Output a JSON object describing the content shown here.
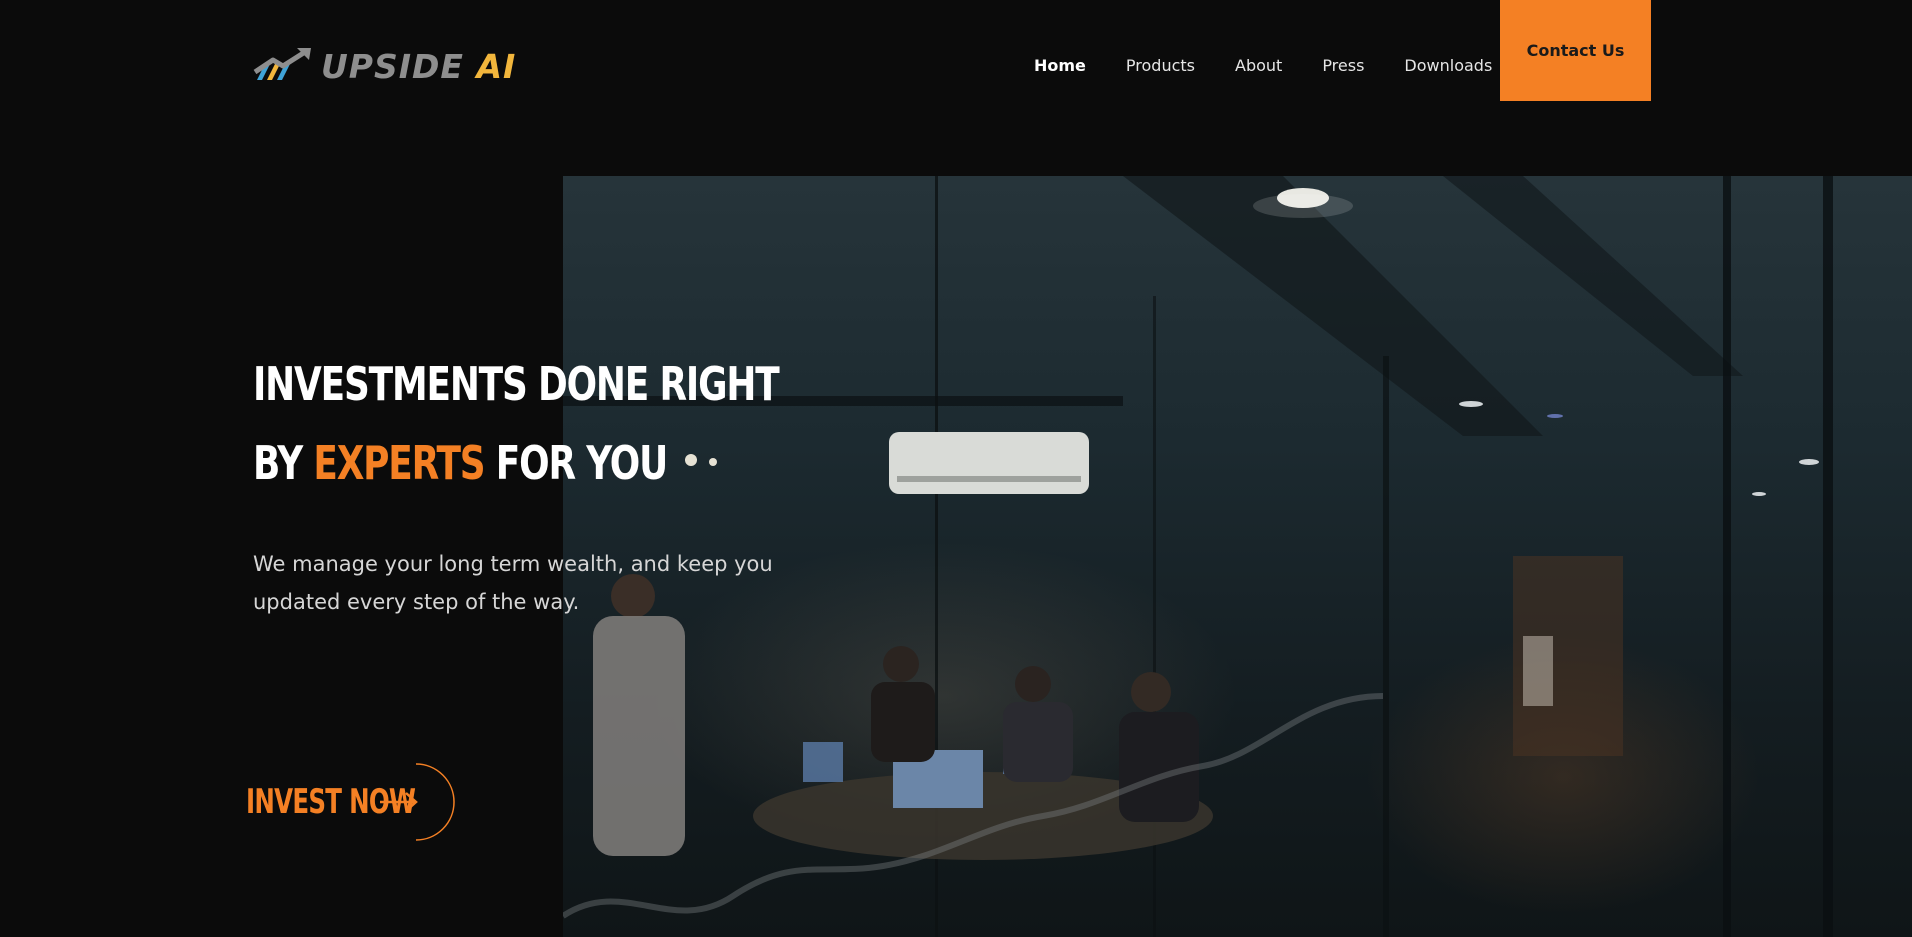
{
  "brand": {
    "name_main": "UPSIDE",
    "name_accent": "AI",
    "logo_icon": "upward-trend-arrow-icon"
  },
  "nav": {
    "items": [
      {
        "label": "Home",
        "active": true
      },
      {
        "label": "Products",
        "active": false
      },
      {
        "label": "About",
        "active": false
      },
      {
        "label": "Press",
        "active": false
      },
      {
        "label": "Downloads",
        "active": false
      }
    ],
    "cta_label": "Contact Us"
  },
  "hero": {
    "line1": "INVESTMENTS DONE RIGHT",
    "line2_prefix": "BY ",
    "line2_accent": "EXPERTS",
    "line2_suffix": " FOR YOU",
    "subtitle": "We manage your long term wealth, and keep you updated every step of the way.",
    "cta_label": "INVEST NOW",
    "cta_icon": "arrow-right-icon"
  },
  "colors": {
    "accent": "#f48024",
    "logo_accent": "#f2b63c",
    "background": "#0b0b0b"
  }
}
